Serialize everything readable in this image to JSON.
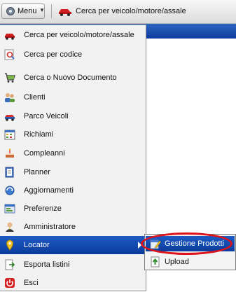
{
  "toolbar": {
    "menu_label": "Menu",
    "menu_icon": "gear-icon",
    "vehicle_search_label": "Cerca per veicolo/motore/assale",
    "vehicle_search_icon": "car-icon"
  },
  "menu": {
    "items": [
      {
        "label": "Cerca per veicolo/motore/assale",
        "icon": "car-icon"
      },
      {
        "label": "Cerca per codice",
        "icon": "search-code-icon"
      },
      {
        "label": "Cerca o Nuovo Documento",
        "icon": "shopping-cart-icon"
      },
      {
        "label": "Clienti",
        "icon": "customers-icon"
      },
      {
        "label": "Parco Veicoli",
        "icon": "vehicle-fleet-icon"
      },
      {
        "label": "Richiami",
        "icon": "calendar-icon"
      },
      {
        "label": "Compleanni",
        "icon": "cake-icon"
      },
      {
        "label": "Planner",
        "icon": "planner-icon"
      },
      {
        "label": "Aggiornamenti",
        "icon": "update-icon"
      },
      {
        "label": "Preferenze",
        "icon": "preferences-icon"
      },
      {
        "label": "Amministratore",
        "icon": "administrator-icon"
      },
      {
        "label": "Locator",
        "icon": "location-pin-icon",
        "active": true
      },
      {
        "label": "Esporta listini",
        "icon": "export-icon"
      },
      {
        "label": "Esci",
        "icon": "power-icon"
      }
    ]
  },
  "submenu": {
    "items": [
      {
        "label": "Gestione Prodotti",
        "icon": "edit-products-icon",
        "active": true
      },
      {
        "label": "Upload",
        "icon": "upload-icon"
      }
    ]
  },
  "colors": {
    "selection": "#0b3b9c",
    "highlight_ring": "#e0121a"
  }
}
